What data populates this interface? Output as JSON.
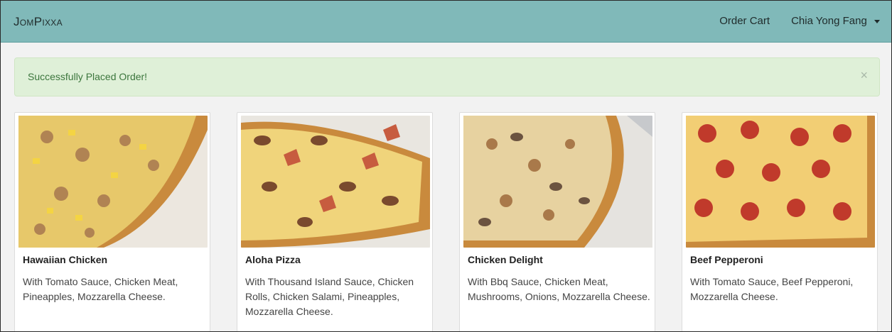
{
  "navbar": {
    "brand": "JomPixxa",
    "links": [
      {
        "label": "Order Cart"
      },
      {
        "label": "Chia Yong Fang"
      }
    ]
  },
  "alert": {
    "message": "Successfully Placed Order!",
    "close_symbol": "×"
  },
  "products": [
    {
      "name": "Hawaiian Chicken",
      "description": "With Tomato Sauce, Chicken Meat, Pineapples, Mozzarella Cheese.",
      "image_icon": "pizza-image"
    },
    {
      "name": "Aloha Pizza",
      "description": "With Thousand Island Sauce, Chicken Rolls, Chicken Salami, Pineapples, Mozzarella Cheese.",
      "image_icon": "pizza-image"
    },
    {
      "name": "Chicken Delight",
      "description": "With Bbq Sauce, Chicken Meat, Mushrooms, Onions, Mozzarella Cheese.",
      "image_icon": "pizza-image"
    },
    {
      "name": "Beef Pepperoni",
      "description": "With Tomato Sauce, Beef Pepperoni, Mozzarella Cheese.",
      "image_icon": "pizza-image"
    }
  ],
  "colors": {
    "navbar": "#80b9b9",
    "alert_bg": "#dff0d8",
    "alert_text": "#3c763d"
  }
}
